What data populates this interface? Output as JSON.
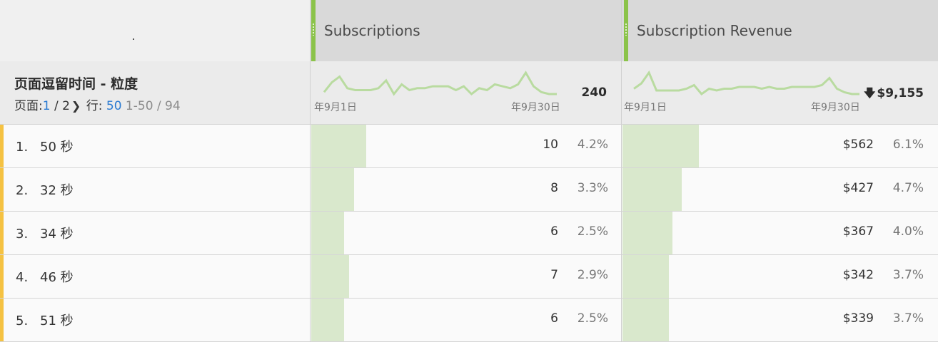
{
  "table": {
    "dimension_title": "页面逗留时间 - 粒度",
    "pager": {
      "page_label": "页面:",
      "page_current": "1",
      "page_total": "/ 2",
      "rows_label": "行:",
      "rows_value": "50",
      "range": "1-50 / 94"
    },
    "columns": [
      {
        "title": "Subscriptions",
        "date_start": "年9月1日",
        "date_end": "年9月30日",
        "total": "240",
        "total_arrow": "",
        "spark_values": [
          8,
          13,
          16,
          10,
          9,
          9,
          9,
          10,
          14,
          7,
          12,
          9,
          10,
          10,
          11,
          11,
          11,
          9,
          11,
          7,
          10,
          9,
          12,
          11,
          10,
          12,
          18,
          11,
          8,
          7,
          7
        ]
      },
      {
        "title": "Subscription Revenue",
        "date_start": "年9月1日",
        "date_end": "年9月30日",
        "total": "$9,155",
        "total_arrow": "🡇",
        "spark_values": [
          10,
          13,
          19,
          9,
          9,
          9,
          9,
          10,
          12,
          7,
          10,
          9,
          10,
          10,
          11,
          11,
          11,
          10,
          11,
          10,
          10,
          11,
          11,
          11,
          11,
          12,
          16,
          10,
          8,
          7,
          7
        ]
      }
    ],
    "rows": [
      {
        "index": "1.",
        "label": "50 秒",
        "subs": "10",
        "subs_pct": "4.2%",
        "subs_frac": 0.042,
        "rev": "$562",
        "rev_pct": "6.1%",
        "rev_frac": 0.061
      },
      {
        "index": "2.",
        "label": "32 秒",
        "subs": "8",
        "subs_pct": "3.3%",
        "subs_frac": 0.033,
        "rev": "$427",
        "rev_pct": "4.7%",
        "rev_frac": 0.047
      },
      {
        "index": "3.",
        "label": "34 秒",
        "subs": "6",
        "subs_pct": "2.5%",
        "subs_frac": 0.025,
        "rev": "$367",
        "rev_pct": "4.0%",
        "rev_frac": 0.04
      },
      {
        "index": "4.",
        "label": "46 秒",
        "subs": "7",
        "subs_pct": "2.9%",
        "subs_frac": 0.029,
        "rev": "$342",
        "rev_pct": "3.7%",
        "rev_frac": 0.037
      },
      {
        "index": "5.",
        "label": "51 秒",
        "subs": "6",
        "subs_pct": "2.5%",
        "subs_frac": 0.025,
        "rev": "$339",
        "rev_pct": "3.7%",
        "rev_frac": 0.037
      }
    ]
  },
  "colors": {
    "accent_green": "#8bc34a",
    "row_marker": "#f5c242",
    "bar_fill": "#d9e8cc",
    "spark_line": "#b9dba0",
    "link_blue": "#2b7bd2"
  },
  "icons": {
    "column_grip": "grip-dots-icon",
    "pager_next": "chevron-right-icon",
    "trend": "arrow-down-icon"
  }
}
